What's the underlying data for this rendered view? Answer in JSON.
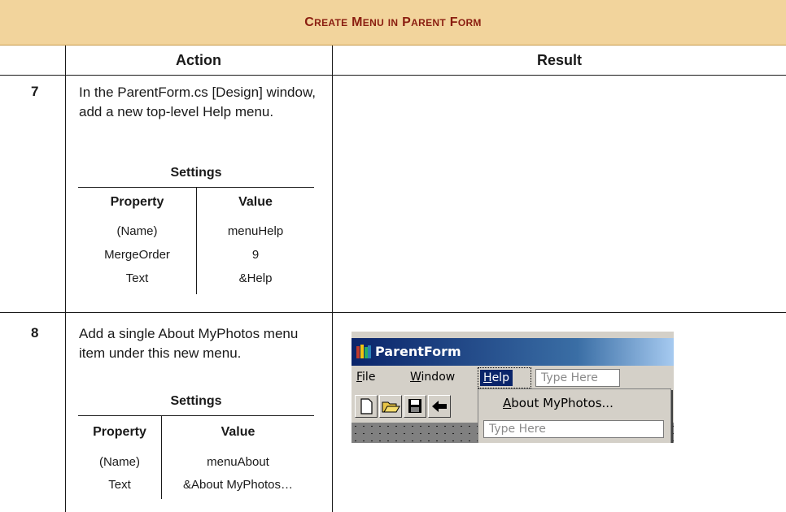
{
  "banner": {
    "first_c": "C",
    "rest_create": "REATE",
    "first_m": "M",
    "rest_menu": "ENU",
    "in_word": "IN",
    "first_p": "P",
    "rest_parent": "ARENT",
    "first_f": "F",
    "rest_form": "ORM"
  },
  "headers": {
    "action": "Action",
    "result": "Result"
  },
  "step7": {
    "num": "7",
    "action": "In the ParentForm.cs [Design] window, add a new top-level Help menu.",
    "settings_title": "Settings",
    "col_property": "Property",
    "col_value": "Value",
    "rows": [
      {
        "property": "(Name)",
        "value": "menuHelp"
      },
      {
        "property": "MergeOrder",
        "value": "9"
      },
      {
        "property": "Text",
        "value": "&Help"
      }
    ]
  },
  "step8": {
    "num": "8",
    "action": "Add a single About MyPhotos menu item under this new menu.",
    "settings_title": "Settings",
    "col_property": "Property",
    "col_value": "Value",
    "rows": [
      {
        "property": "(Name)",
        "value": "menuAbout"
      },
      {
        "property": "Text",
        "value": "&About MyPhotos…"
      }
    ]
  },
  "screenshot": {
    "title": "ParentForm",
    "menu_file_ul": "F",
    "menu_file_rest": "ile",
    "menu_window_ul": "W",
    "menu_window_rest": "indow",
    "menu_help_ul": "H",
    "menu_help_rest": "elp",
    "type_here": "Type Here",
    "about_ul": "A",
    "about_rest": "bout MyPhotos...",
    "colors": {
      "titlebar": "#0a246a",
      "window_bg": "#d4d0c8"
    }
  },
  "colors": {
    "banner_bg": "#f2d49c",
    "banner_text": "#8a1d10"
  }
}
